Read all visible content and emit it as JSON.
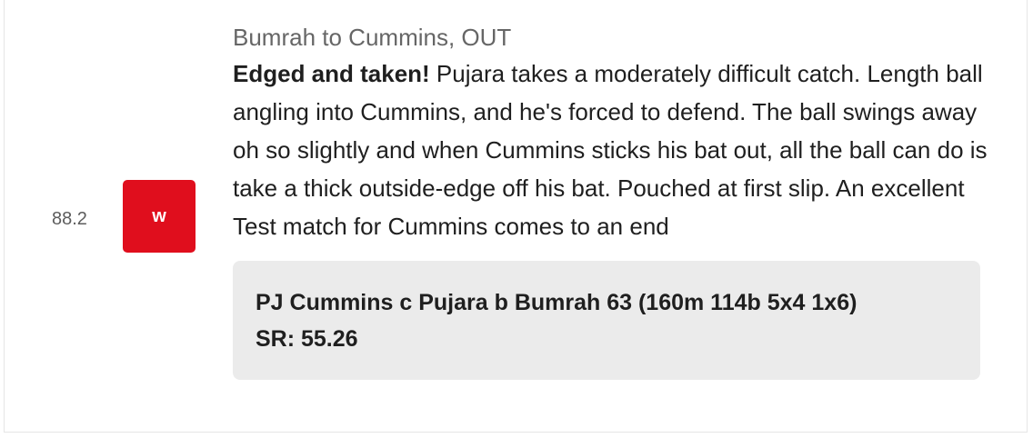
{
  "ball": {
    "over": "88.2",
    "result_badge": "w",
    "badge_color": "#e00e1d"
  },
  "commentary": {
    "headline": "Bumrah to Cummins, OUT",
    "emphasis": "Edged and taken!",
    "text": " Pujara takes a moderately difficult catch. Length ball angling into Cummins, and he's forced to defend. The ball swings away oh so slightly and when Cummins sticks his bat out, all the ball can do is take a thick outside-edge off his bat. Pouched at first slip. An excellent Test match for Cummins comes to an end"
  },
  "dismissal": {
    "line1": "PJ Cummins c Pujara b Bumrah 63 (160m 114b 5x4 1x6)",
    "line2": "SR: 55.26"
  }
}
